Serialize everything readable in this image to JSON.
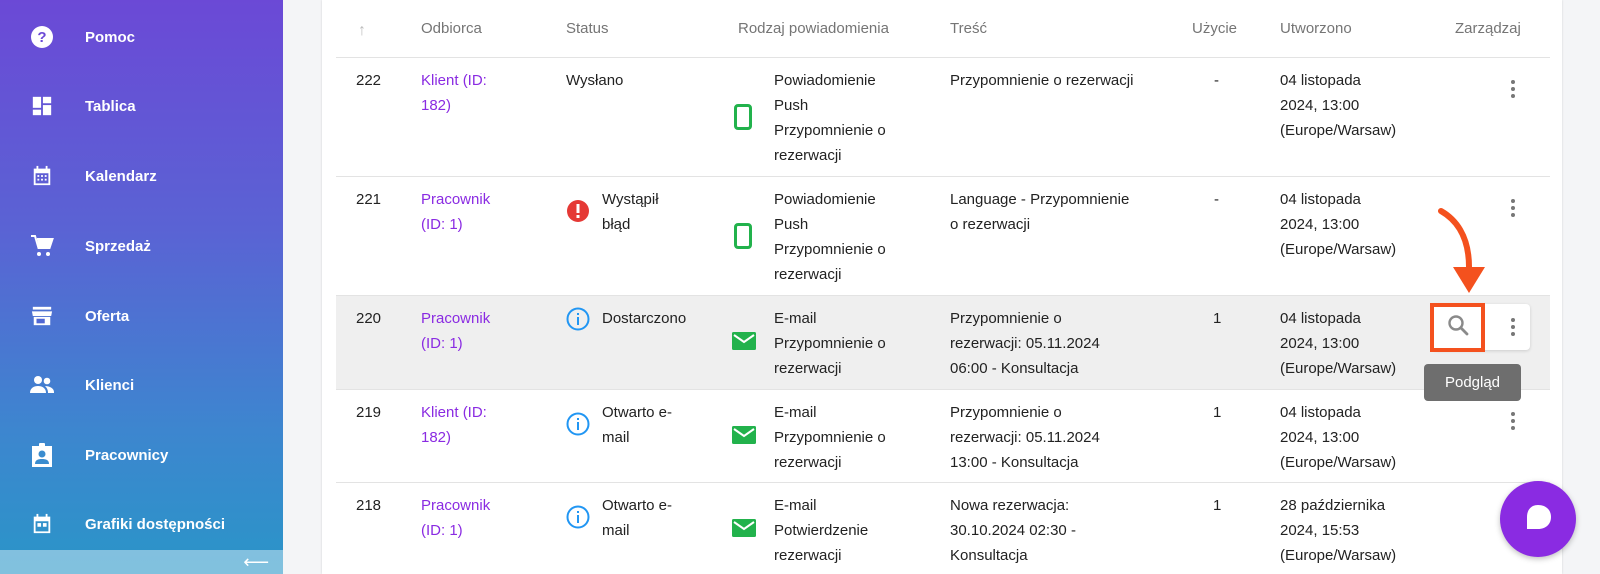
{
  "sidebar": {
    "items": [
      {
        "label": "Pomoc",
        "icon": "help-icon"
      },
      {
        "label": "Tablica",
        "icon": "dashboard-icon"
      },
      {
        "label": "Kalendarz",
        "icon": "calendar-icon"
      },
      {
        "label": "Sprzedaż",
        "icon": "cart-icon"
      },
      {
        "label": "Oferta",
        "icon": "store-icon"
      },
      {
        "label": "Klienci",
        "icon": "people-icon"
      },
      {
        "label": "Pracownicy",
        "icon": "badge-icon"
      },
      {
        "label": "Grafiki dostępności",
        "icon": "schedule-icon"
      }
    ],
    "collapse_glyph": "⟵"
  },
  "table": {
    "headers": {
      "sort": "↑",
      "recipient": "Odbiorca",
      "status": "Status",
      "type": "Rodzaj powiadomienia",
      "content": "Treść",
      "usage": "Użycie",
      "created": "Utworzono",
      "manage": "Zarządzaj"
    },
    "rows": [
      {
        "id": "222",
        "recipient": [
          "Klient (ID:",
          "182)"
        ],
        "status_icon": "none",
        "status": [
          "Wysłano"
        ],
        "type_icon": "phone-icon",
        "type": [
          "Powiadomienie",
          "Push",
          "Przypomnienie o",
          "rezerwacji"
        ],
        "content": [
          "Przypomnienie o rezerwacji"
        ],
        "usage": "-",
        "created": [
          "04 listopada",
          "2024, 13:00",
          "(Europe/Warsaw)"
        ]
      },
      {
        "id": "221",
        "recipient": [
          "Pracownik",
          "(ID: 1)"
        ],
        "status_icon": "error-icon",
        "status": [
          "Wystąpił",
          "błąd"
        ],
        "type_icon": "phone-icon",
        "type": [
          "Powiadomienie",
          "Push",
          "Przypomnienie o",
          "rezerwacji"
        ],
        "content": [
          "Language - Przypomnienie",
          "o rezerwacji"
        ],
        "usage": "-",
        "created": [
          "04 listopada",
          "2024, 13:00",
          "(Europe/Warsaw)"
        ]
      },
      {
        "id": "220",
        "recipient": [
          "Pracownik",
          "(ID: 1)"
        ],
        "status_icon": "info-icon",
        "status": [
          "Dostarczono"
        ],
        "type_icon": "mail-icon",
        "type": [
          "E-mail",
          "Przypomnienie o",
          "rezerwacji"
        ],
        "content": [
          "Przypomnienie o",
          "rezerwacji: 05.11.2024",
          "06:00 - Konsultacja"
        ],
        "usage": "1",
        "created": [
          "04 listopada",
          "2024, 13:00",
          "(Europe/Warsaw)"
        ]
      },
      {
        "id": "219",
        "recipient": [
          "Klient (ID:",
          "182)"
        ],
        "status_icon": "info-icon",
        "status": [
          "Otwarto e-",
          "mail"
        ],
        "type_icon": "mail-icon",
        "type": [
          "E-mail",
          "Przypomnienie o",
          "rezerwacji"
        ],
        "content": [
          "Przypomnienie o",
          "rezerwacji: 05.11.2024",
          "13:00 - Konsultacja"
        ],
        "usage": "1",
        "created": [
          "04 listopada",
          "2024, 13:00",
          "(Europe/Warsaw)"
        ]
      },
      {
        "id": "218",
        "recipient": [
          "Pracownik",
          "(ID: 1)"
        ],
        "status_icon": "info-icon",
        "status": [
          "Otwarto e-",
          "mail"
        ],
        "type_icon": "mail-icon",
        "type": [
          "E-mail",
          "Potwierdzenie",
          "rezerwacji"
        ],
        "content": [
          "Nowa rezerwacja:",
          "30.10.2024 02:30 -",
          "Konsultacja"
        ],
        "usage": "1",
        "created": [
          "28 października",
          "2024, 15:53",
          "(Europe/Warsaw)"
        ]
      }
    ]
  },
  "tooltip": "Podgląd",
  "colors": {
    "link": "#8a2be2",
    "highlight": "#f4511e",
    "error": "#e53935",
    "info": "#2196f3",
    "type_icon": "#22b24c"
  }
}
